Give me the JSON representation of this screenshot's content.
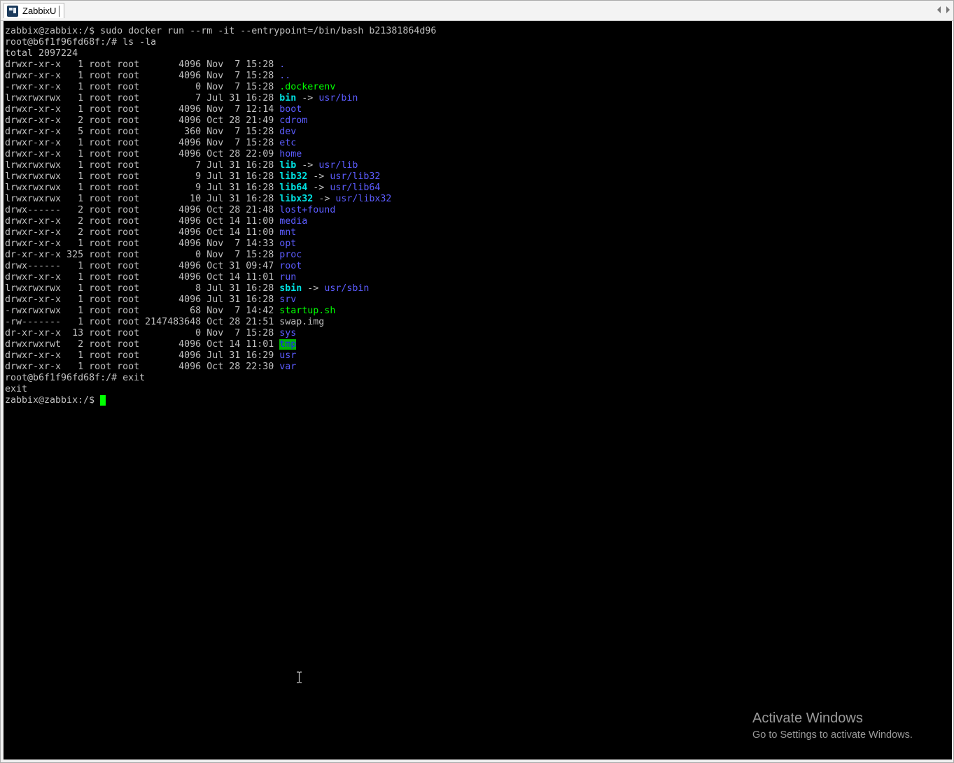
{
  "window": {
    "tab_title": "ZabbixU"
  },
  "icons": {
    "tab_icon": "terminal-app-icon",
    "scroll_left": "chevron-left-icon",
    "scroll_right": "chevron-right-icon",
    "text_cursor": "ibeam-cursor-icon"
  },
  "colors": {
    "terminal_bg": "#000000",
    "text": "#c0c0c0",
    "directory": "#5c5cff",
    "symlink": "#00e0e0",
    "executable": "#00ff00",
    "sticky_bg": "#00b000",
    "cursor": "#00ff00"
  },
  "terminal": {
    "lines": [
      {
        "segments": [
          {
            "t": "zabbix@zabbix:/$ sudo docker run --rm -it --entrypoint=/bin/bash b21381864d96"
          }
        ]
      },
      {
        "segments": [
          {
            "t": "root@b6f1f96fd68f:/# ls -la"
          }
        ]
      },
      {
        "segments": [
          {
            "t": "total 2097224"
          }
        ]
      },
      {
        "segments": [
          {
            "t": "drwxr-xr-x   1 root root       4096 Nov  7 15:28 "
          },
          {
            "t": ".",
            "c": "dir"
          }
        ]
      },
      {
        "segments": [
          {
            "t": "drwxr-xr-x   1 root root       4096 Nov  7 15:28 "
          },
          {
            "t": "..",
            "c": "dir"
          }
        ]
      },
      {
        "segments": [
          {
            "t": "-rwxr-xr-x   1 root root          0 Nov  7 15:28 "
          },
          {
            "t": ".dockerenv",
            "c": "exec"
          }
        ]
      },
      {
        "segments": [
          {
            "t": "lrwxrwxrwx   1 root root          7 Jul 31 16:28 "
          },
          {
            "t": "bin",
            "c": "link"
          },
          {
            "t": " -> "
          },
          {
            "t": "usr/bin",
            "c": "linktarget"
          }
        ]
      },
      {
        "segments": [
          {
            "t": "drwxr-xr-x   1 root root       4096 Nov  7 12:14 "
          },
          {
            "t": "boot",
            "c": "dir"
          }
        ]
      },
      {
        "segments": [
          {
            "t": "drwxr-xr-x   2 root root       4096 Oct 28 21:49 "
          },
          {
            "t": "cdrom",
            "c": "dir"
          }
        ]
      },
      {
        "segments": [
          {
            "t": "drwxr-xr-x   5 root root        360 Nov  7 15:28 "
          },
          {
            "t": "dev",
            "c": "dir"
          }
        ]
      },
      {
        "segments": [
          {
            "t": "drwxr-xr-x   1 root root       4096 Nov  7 15:28 "
          },
          {
            "t": "etc",
            "c": "dir"
          }
        ]
      },
      {
        "segments": [
          {
            "t": "drwxr-xr-x   1 root root       4096 Oct 28 22:09 "
          },
          {
            "t": "home",
            "c": "dir"
          }
        ]
      },
      {
        "segments": [
          {
            "t": "lrwxrwxrwx   1 root root          7 Jul 31 16:28 "
          },
          {
            "t": "lib",
            "c": "link"
          },
          {
            "t": " -> "
          },
          {
            "t": "usr/lib",
            "c": "linktarget"
          }
        ]
      },
      {
        "segments": [
          {
            "t": "lrwxrwxrwx   1 root root          9 Jul 31 16:28 "
          },
          {
            "t": "lib32",
            "c": "link"
          },
          {
            "t": " -> "
          },
          {
            "t": "usr/lib32",
            "c": "linktarget"
          }
        ]
      },
      {
        "segments": [
          {
            "t": "lrwxrwxrwx   1 root root          9 Jul 31 16:28 "
          },
          {
            "t": "lib64",
            "c": "link"
          },
          {
            "t": " -> "
          },
          {
            "t": "usr/lib64",
            "c": "linktarget"
          }
        ]
      },
      {
        "segments": [
          {
            "t": "lrwxrwxrwx   1 root root         10 Jul 31 16:28 "
          },
          {
            "t": "libx32",
            "c": "link"
          },
          {
            "t": " -> "
          },
          {
            "t": "usr/libx32",
            "c": "linktarget"
          }
        ]
      },
      {
        "segments": [
          {
            "t": "drwx------   2 root root       4096 Oct 28 21:48 "
          },
          {
            "t": "lost+found",
            "c": "dir"
          }
        ]
      },
      {
        "segments": [
          {
            "t": "drwxr-xr-x   2 root root       4096 Oct 14 11:00 "
          },
          {
            "t": "media",
            "c": "dir"
          }
        ]
      },
      {
        "segments": [
          {
            "t": "drwxr-xr-x   2 root root       4096 Oct 14 11:00 "
          },
          {
            "t": "mnt",
            "c": "dir"
          }
        ]
      },
      {
        "segments": [
          {
            "t": "drwxr-xr-x   1 root root       4096 Nov  7 14:33 "
          },
          {
            "t": "opt",
            "c": "dir"
          }
        ]
      },
      {
        "segments": [
          {
            "t": "dr-xr-xr-x 325 root root          0 Nov  7 15:28 "
          },
          {
            "t": "proc",
            "c": "dir"
          }
        ]
      },
      {
        "segments": [
          {
            "t": "drwx------   1 root root       4096 Oct 31 09:47 "
          },
          {
            "t": "root",
            "c": "dir"
          }
        ]
      },
      {
        "segments": [
          {
            "t": "drwxr-xr-x   1 root root       4096 Oct 14 11:01 "
          },
          {
            "t": "run",
            "c": "dir"
          }
        ]
      },
      {
        "segments": [
          {
            "t": "lrwxrwxrwx   1 root root          8 Jul 31 16:28 "
          },
          {
            "t": "sbin",
            "c": "link"
          },
          {
            "t": " -> "
          },
          {
            "t": "usr/sbin",
            "c": "linktarget"
          }
        ]
      },
      {
        "segments": [
          {
            "t": "drwxr-xr-x   1 root root       4096 Jul 31 16:28 "
          },
          {
            "t": "srv",
            "c": "dir"
          }
        ]
      },
      {
        "segments": [
          {
            "t": "-rwxrwxrwx   1 root root         68 Nov  7 14:42 "
          },
          {
            "t": "startup.sh",
            "c": "exec"
          }
        ]
      },
      {
        "segments": [
          {
            "t": "-rw-------   1 root root 2147483648 Oct 28 21:51 swap.img"
          }
        ]
      },
      {
        "segments": [
          {
            "t": "dr-xr-xr-x  13 root root          0 Nov  7 15:28 "
          },
          {
            "t": "sys",
            "c": "dir"
          }
        ]
      },
      {
        "segments": [
          {
            "t": "drwxrwxrwt   2 root root       4096 Oct 14 11:01 "
          },
          {
            "t": "tmp",
            "c": "sticky"
          }
        ]
      },
      {
        "segments": [
          {
            "t": "drwxr-xr-x   1 root root       4096 Jul 31 16:29 "
          },
          {
            "t": "usr",
            "c": "dir"
          }
        ]
      },
      {
        "segments": [
          {
            "t": "drwxr-xr-x   1 root root       4096 Oct 28 22:30 "
          },
          {
            "t": "var",
            "c": "dir"
          }
        ]
      },
      {
        "segments": [
          {
            "t": "root@b6f1f96fd68f:/# exit"
          }
        ]
      },
      {
        "segments": [
          {
            "t": "exit"
          }
        ]
      },
      {
        "segments": [
          {
            "t": "zabbix@zabbix:/$ "
          }
        ],
        "cursor": true
      }
    ]
  },
  "watermark": {
    "title": "Activate Windows",
    "subtitle": "Go to Settings to activate Windows."
  }
}
